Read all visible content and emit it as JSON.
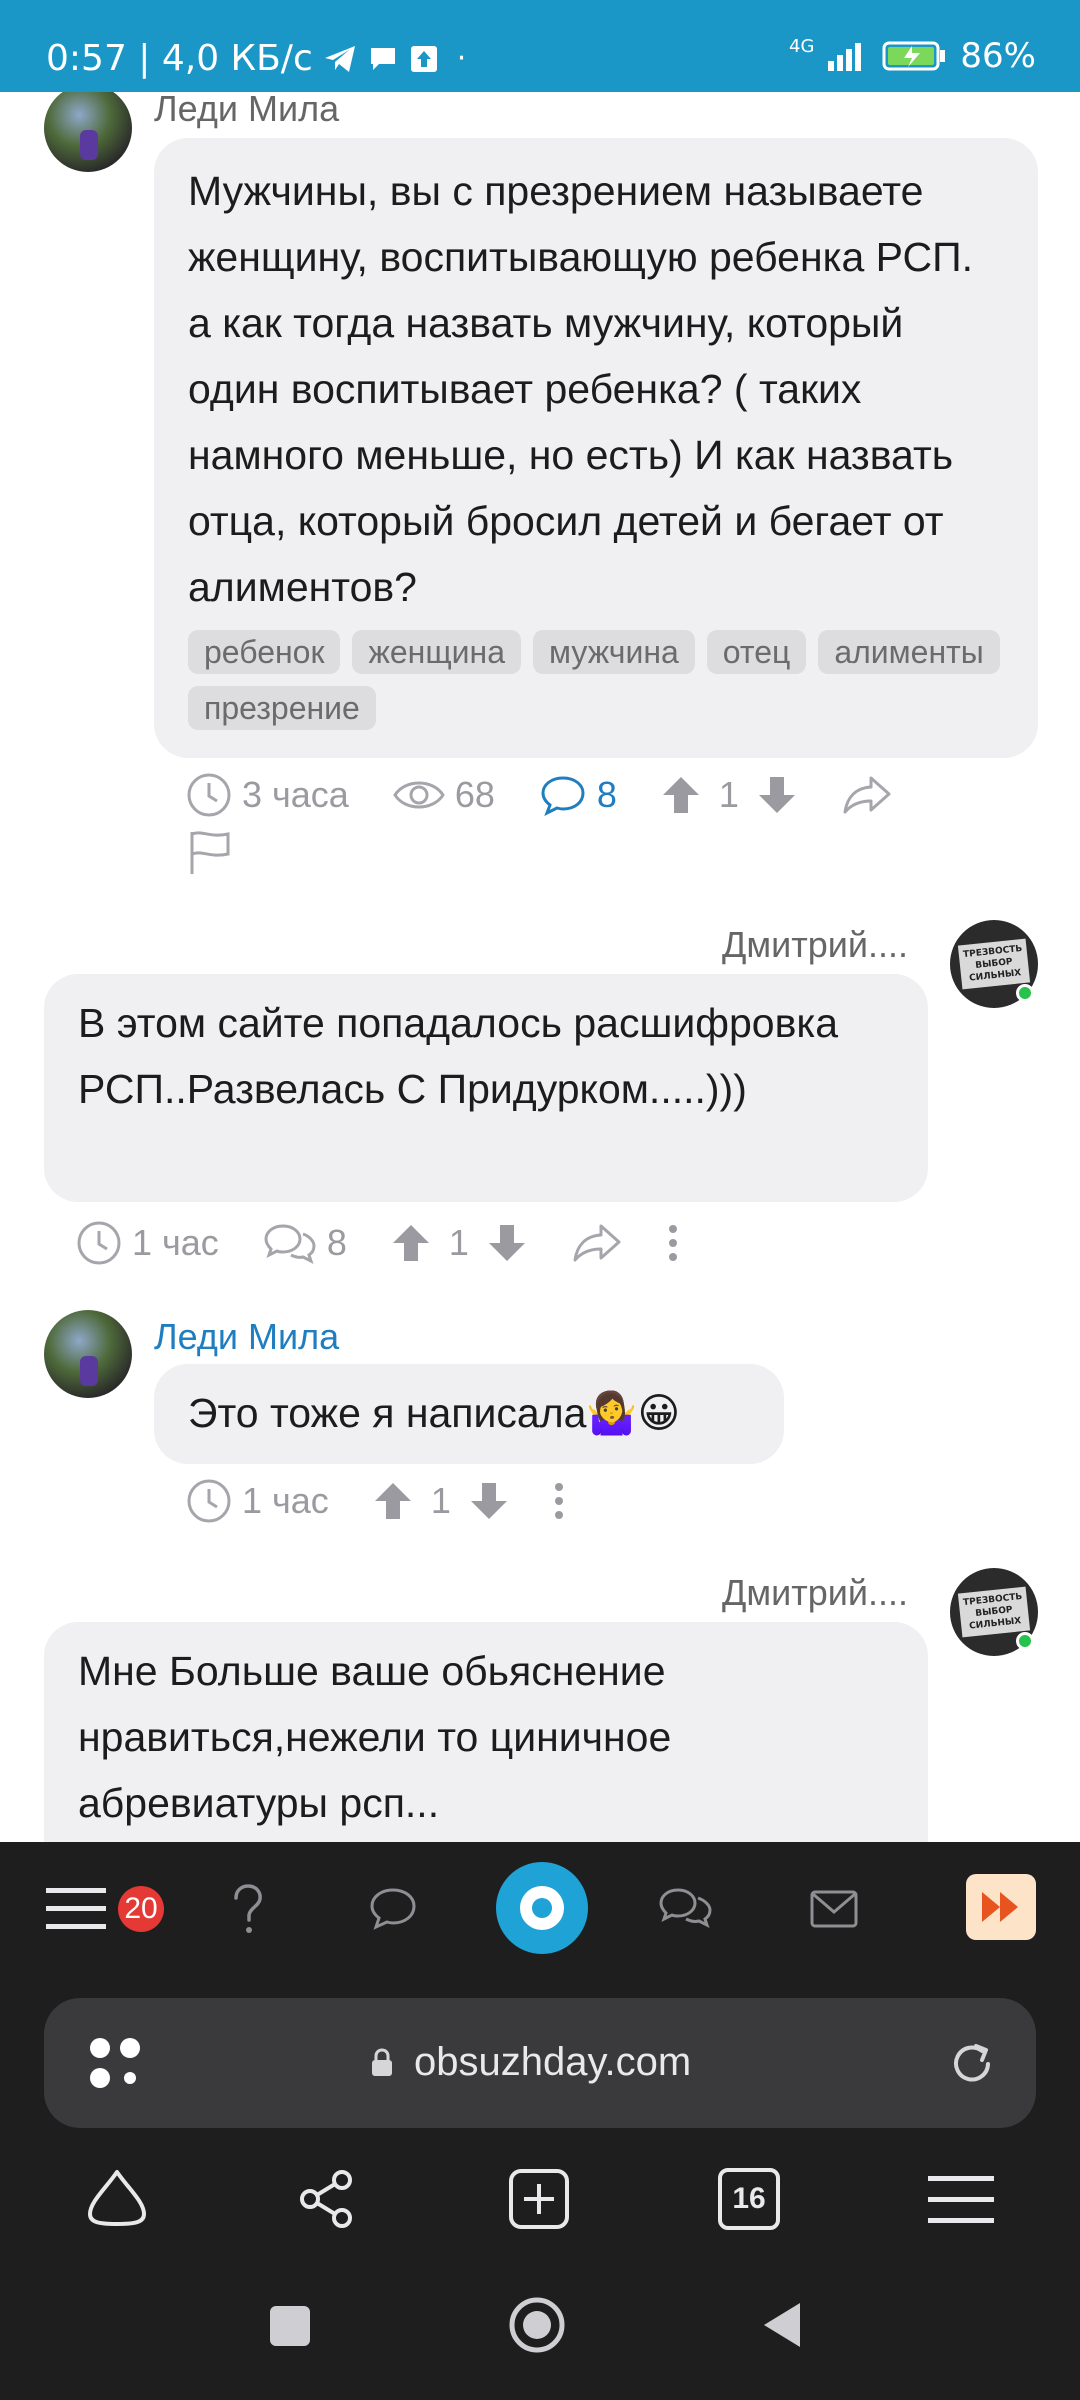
{
  "status_bar": {
    "time_speed": "0:57 | 4,0 КБ/с",
    "network": "4G",
    "battery": "86%"
  },
  "posts": [
    {
      "author": "Леди Мила",
      "text": "Мужчины, вы с презрением называете женщину, воспитывающую ребенка РСП. а как тогда назвать мужчину, который один воспитывает ребенка? ( таких намного меньше, но есть) И как назвать отца, который бросил детей и бегает от алиментов?",
      "tags": [
        "ребенок",
        "женщина",
        "мужчина",
        "отец",
        "алименты",
        "презрение"
      ],
      "time": "3 часа",
      "views": "68",
      "comments": "8",
      "rating": "1"
    },
    {
      "author": "Дмитрий....",
      "text": "В этом сайте попадалось расшифровка РСП..Развелась С Придурком.....)))",
      "time": "1 час",
      "comments": "8",
      "rating": "1"
    },
    {
      "author": "Леди Мила",
      "text": "Это тоже я написала🤷‍♀️😀",
      "time": "1 час",
      "rating": "1"
    },
    {
      "author": "Дмитрий....",
      "text": "Мне Больше ваше обьяснение нравиться,нежели то циничное абревиатуры рсп..."
    }
  ],
  "site_nav": {
    "badge": "20"
  },
  "browser": {
    "url": "obsuzhday.com",
    "tabs_count": "16"
  },
  "avatar_sign_text": "ТРЕЗВОСТЬ ВЫБОР СИЛЬНЫХ",
  "colors": {
    "status_bar": "#1a97c6",
    "accent_blue": "#1f7ec0",
    "bubble_bg": "#f0f0f2",
    "badge_red": "#e53935",
    "dark_bar": "#1e1e1f"
  }
}
